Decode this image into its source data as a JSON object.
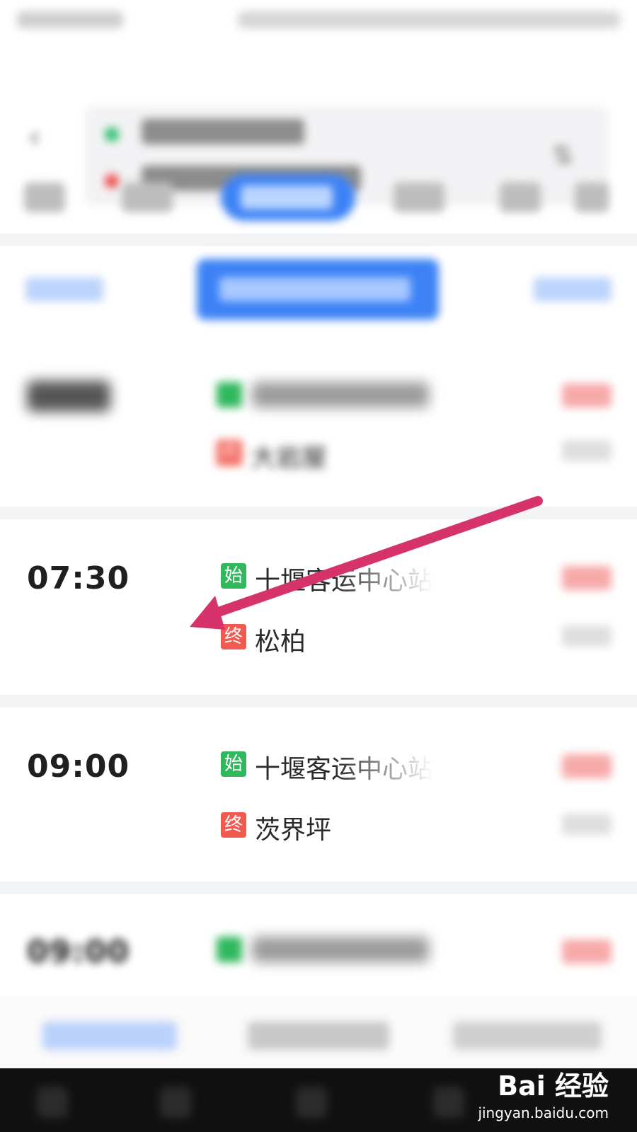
{
  "header": {
    "back_icon": "back-icon",
    "swap_icon": "swap-icon"
  },
  "trips": [
    {
      "time": "07:30",
      "start_badge": "始",
      "start_stop": "十堰客运中心站",
      "end_badge": "终",
      "end_stop": "松柏"
    },
    {
      "time": "09:00",
      "start_badge": "始",
      "start_stop": "十堰客运中心站",
      "end_badge": "终",
      "end_stop": "茨界坪"
    }
  ],
  "blurred_items": {
    "top_trip": {
      "end_badge": "终",
      "end_stop": "大岩屋"
    },
    "bottom_trip": {
      "time": "09:00"
    }
  },
  "watermark": {
    "logo": "Bai 经验",
    "url": "jingyan.baidu.com"
  },
  "colors": {
    "accent_blue": "#3c82f6",
    "start_green": "#2fb85c",
    "end_red": "#f25a4f",
    "annotation_arrow": "#d6336c"
  }
}
